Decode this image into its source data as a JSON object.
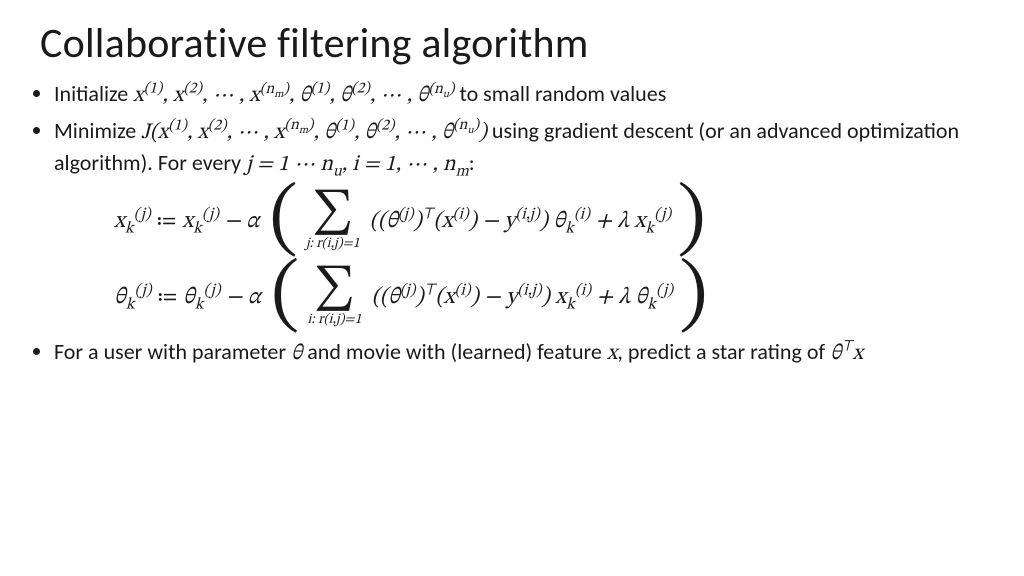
{
  "title": "Collaborative filtering algorithm",
  "bullets": {
    "b1_prefix": "Initialize ",
    "b1_math": "x<sup>(1)</sup>, x<sup>(2)</sup>, ⋯ , x<sup>(n<sub>m</sub>)</sup>, θ<sup>(1)</sup>, θ<sup>(2)</sup>, ⋯ , θ<sup>(n<sub>u</sub>)</sup>",
    "b1_suffix": " to small random values",
    "b2_prefix": "Minimize ",
    "b2_math": "J(x<sup>(1)</sup>, x<sup>(2)</sup>, ⋯ , x<sup>(n<sub>m</sub>)</sup>, θ<sup>(1)</sup>, θ<sup>(2)</sup>, ⋯ , θ<sup>(n<sub>u</sub>)</sup>)",
    "b2_suffix_a": " using gradient descent (or an advanced optimization algorithm). For every ",
    "b2_math_tail": "j = 1 ⋯ n<sub>u</sub>, i = 1, ⋯ , n<sub>m</sub>",
    "b2_colon": ":",
    "b3_prefix": "For a user with parameter ",
    "b3_math1": "θ",
    "b3_mid": " and movie with (learned) feature ",
    "b3_math2": "x",
    "b3_suffix": ", predict a star rating of ",
    "b3_math3": "θ<sup>⊤</sup>x"
  },
  "equations": {
    "eq1": {
      "lhs": "x<sub>k</sub><sup>(j)</sup>",
      "assign": "≔",
      "rhs1": "x<sub>k</sub><sup>(j)</sup> − α",
      "sum_limit": "j: r(i,j)=1",
      "inner": "((θ<sup>(j)</sup>)<sup>⊤</sup>(x<sup>(i)</sup>) − y<sup>(i,j)</sup>) θ<sub>k</sub><sup>(i)</sup> + λ x<sub>k</sub><sup>(j)</sup>"
    },
    "eq2": {
      "lhs": "θ<sub>k</sub><sup>(j)</sup>",
      "assign": "≔",
      "rhs1": "θ<sub>k</sub><sup>(j)</sup> − α",
      "sum_limit": "i: r(i,j)=1",
      "inner": "((θ<sup>(j)</sup>)<sup>⊤</sup>(x<sup>(i)</sup>) − y<sup>(i,j)</sup>) x<sub>k</sub><sup>(i)</sup> + λ θ<sub>k</sub><sup>(j)</sup>"
    }
  }
}
